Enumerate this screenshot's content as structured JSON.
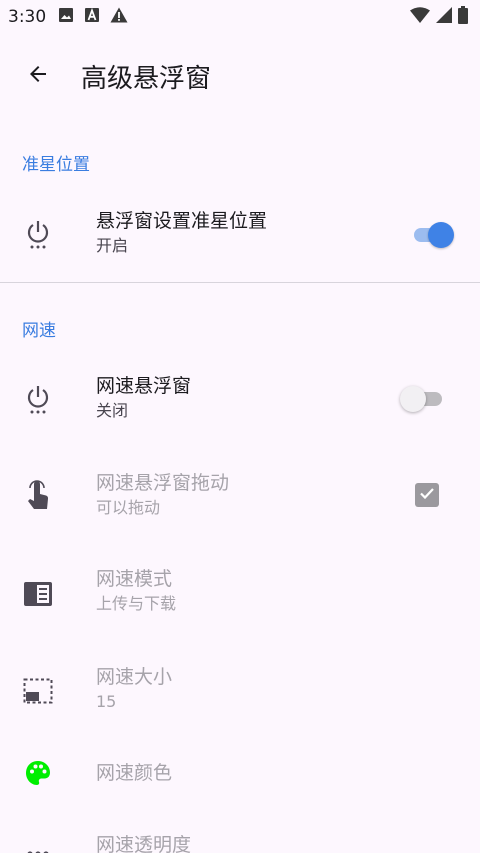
{
  "status_bar": {
    "time": "3:30",
    "left_icons": [
      "image-icon",
      "font-a-icon",
      "warning-icon"
    ],
    "right_icons": [
      "wifi-icon",
      "signal-icon",
      "battery-icon"
    ]
  },
  "app_bar": {
    "back_icon": "arrow-back-icon",
    "title": "高级悬浮窗"
  },
  "sections": [
    {
      "header": "准星位置",
      "items": [
        {
          "title": "悬浮窗设置准星位置",
          "summary": "开启",
          "icon": "power-icon",
          "control": "switch",
          "checked": true,
          "enabled": true
        }
      ]
    },
    {
      "header": "网速",
      "items": [
        {
          "title": "网速悬浮窗",
          "summary": "关闭",
          "icon": "power-icon",
          "control": "switch",
          "checked": false,
          "enabled": true
        },
        {
          "title": "网速悬浮窗拖动",
          "summary": "可以拖动",
          "icon": "touch-icon",
          "control": "checkbox",
          "checked": true,
          "enabled": false
        },
        {
          "title": "网速模式",
          "summary": "上传与下载",
          "icon": "list-panel-icon",
          "enabled": false
        },
        {
          "title": "网速大小",
          "summary": "15",
          "icon": "resize-icon",
          "enabled": false
        },
        {
          "title": "网速颜色",
          "icon": "palette-icon",
          "icon_color": "#00ee00",
          "enabled": false
        },
        {
          "title": "网速透明度",
          "icon": "dots-icon",
          "enabled": false
        }
      ]
    }
  ],
  "colors": {
    "accent": "#3f82e6",
    "section_header": "#3a7de0",
    "background": "#fdf7fe"
  }
}
